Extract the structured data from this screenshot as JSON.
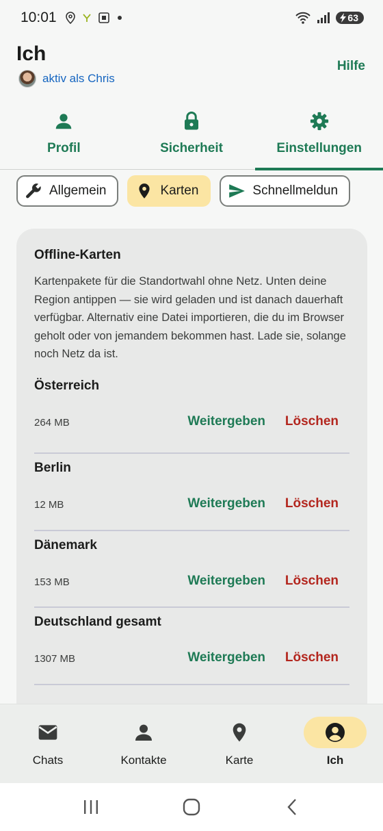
{
  "status_bar": {
    "time": "10:01",
    "battery": "63"
  },
  "header": {
    "title": "Ich",
    "active_as": "aktiv als Chris",
    "help": "Hilfe"
  },
  "main_tabs": [
    {
      "label": "Profil",
      "icon": "person-icon"
    },
    {
      "label": "Sicherheit",
      "icon": "lock-icon"
    },
    {
      "label": "Einstellungen",
      "icon": "gear-icon",
      "active": true
    }
  ],
  "chips": [
    {
      "label": "Allgemein",
      "icon": "wrench-icon"
    },
    {
      "label": "Karten",
      "icon": "pin-icon",
      "active": true
    },
    {
      "label": "Schnellmeldun",
      "icon": "send-icon"
    }
  ],
  "offline_maps": {
    "title": "Offline-Karten",
    "description": "Kartenpakete für die Standortwahl ohne Netz. Unten deine Region antippen — sie wird geladen und ist danach dauerhaft verfügbar. Alternativ eine Datei importieren, die du im Browser geholt oder von jemandem bekommen hast. Lade sie, solange noch Netz da ist.",
    "share_label": "Weitergeben",
    "delete_label": "Löschen",
    "items": [
      {
        "name": "Österreich",
        "size": "264 MB"
      },
      {
        "name": "Berlin",
        "size": "12 MB"
      },
      {
        "name": "Dänemark",
        "size": "153 MB"
      },
      {
        "name": "Deutschland gesamt",
        "size": "1307 MB"
      }
    ]
  },
  "bottom_nav": [
    {
      "label": "Chats",
      "icon": "mail-icon"
    },
    {
      "label": "Kontakte",
      "icon": "person-icon"
    },
    {
      "label": "Karte",
      "icon": "pin-icon"
    },
    {
      "label": "Ich",
      "icon": "account-circle-icon",
      "active": true
    }
  ],
  "colors": {
    "accent": "#1e7a55",
    "danger": "#b3261e",
    "active_chip": "#fbe5a3",
    "link": "#1565c0"
  }
}
